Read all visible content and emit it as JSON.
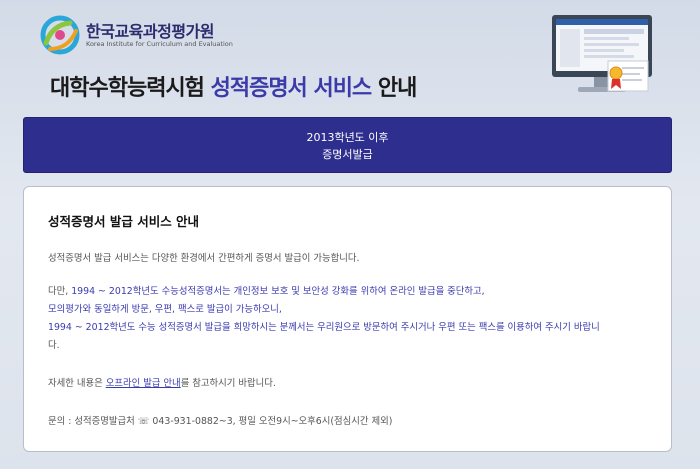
{
  "header": {
    "logo_korean": "한국교육과정평가원",
    "logo_english": "Korea Institute for Curriculum and Evaluation",
    "title_prefix": "대학수학능력시험 ",
    "title_accent": "성적증명서 서비스",
    "title_suffix": " 안내"
  },
  "banner": {
    "line1": "2013학년도 이후",
    "line2": "증명서발급"
  },
  "card": {
    "title": "성적증명서 발급 서비스 안내",
    "intro": "성적증명서 발급 서비스는 다양한 환경에서 간편하게 증명서 발급이 가능합니다.",
    "notice_prefix": "다만, ",
    "notice_line1": "1994 ~ 2012학년도 수능성적증명서는 개인정보 보호 및 보안성 강화를 위하여 온라인 발급을 중단하고,",
    "notice_line2": "모의평가와 동일하게 방문, 우편, 팩스로 발급이 가능하오니,",
    "notice_line3": "1994 ~ 2012학년도 수능 성적증명서 발급을 희망하시는 분께서는 우리원으로 방문하여 주시거나 우편 또는 팩스를 이용하여 주시기 바랍니",
    "notice_line4": "다.",
    "detail_prefix": "자세한 내용은 ",
    "detail_link": "오프라인 발급 안내",
    "detail_suffix": "를 참고하시기 바랍니다.",
    "contact": "문의 : 성적증명발급처 ☏ 043-931-0882~3, 평일 오전9시~오후6시(점심시간 제외)"
  },
  "colors": {
    "accent": "#3a3aa8",
    "banner_bg": "#2e2e8e"
  }
}
